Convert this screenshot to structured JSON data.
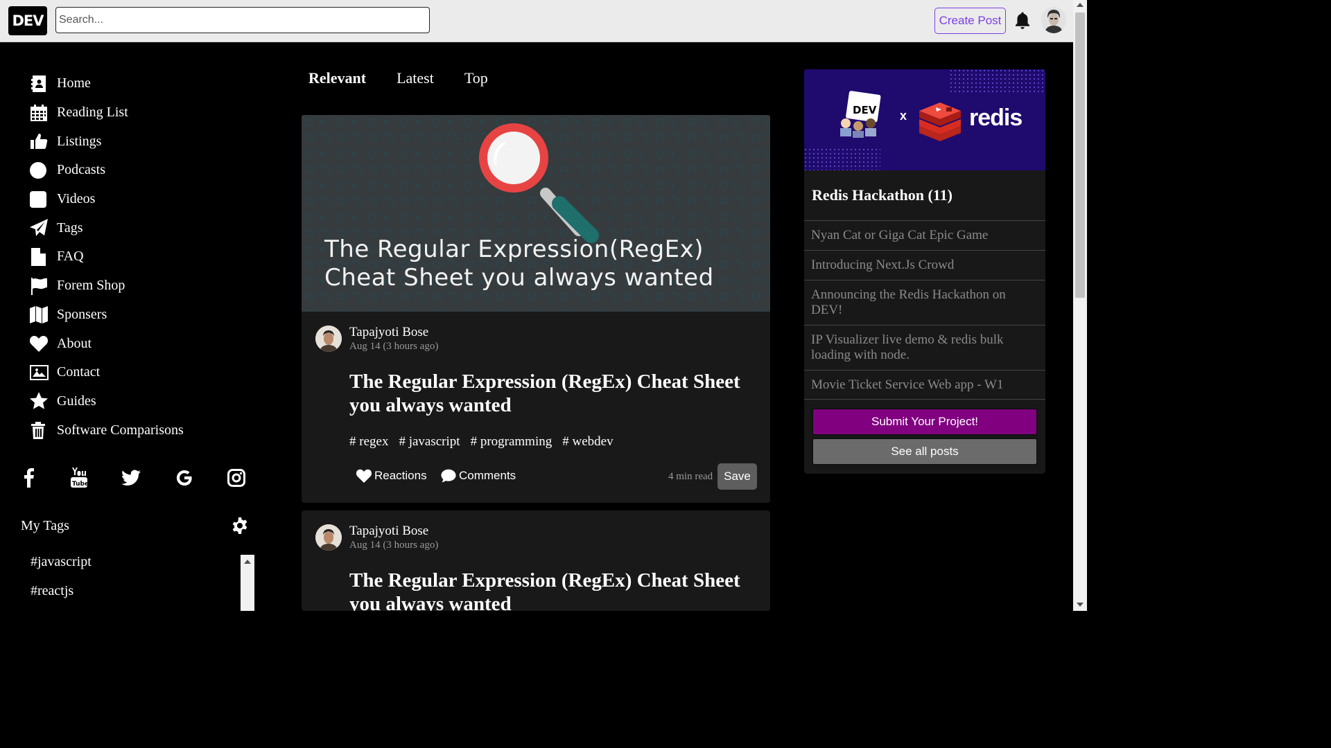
{
  "header": {
    "logo_text": "DEV",
    "search_placeholder": "Search...",
    "create_post_label": "Create Post"
  },
  "sidebar": {
    "items": [
      {
        "label": "Home",
        "icon": "contact-card-icon"
      },
      {
        "label": "Reading List",
        "icon": "calendar-icon"
      },
      {
        "label": "Listings",
        "icon": "thumbs-up-icon"
      },
      {
        "label": "Podcasts",
        "icon": "circle-icon"
      },
      {
        "label": "Videos",
        "icon": "square-icon"
      },
      {
        "label": "Tags",
        "icon": "paper-plane-icon"
      },
      {
        "label": "FAQ",
        "icon": "file-icon"
      },
      {
        "label": "Forem Shop",
        "icon": "flag-icon"
      },
      {
        "label": "Sponsers",
        "icon": "map-icon"
      },
      {
        "label": "About",
        "icon": "heart-icon"
      },
      {
        "label": "Contact",
        "icon": "image-icon"
      },
      {
        "label": "Guides",
        "icon": "star-icon"
      },
      {
        "label": "Software Comparisons",
        "icon": "trash-icon"
      }
    ],
    "social": [
      "facebook-icon",
      "youtube-icon",
      "twitter-icon",
      "google-icon",
      "instagram-icon"
    ],
    "my_tags_title": "My Tags",
    "tags": [
      "#javascript",
      "#reactjs"
    ]
  },
  "feed": {
    "tabs": [
      {
        "label": "Relevant",
        "active": true
      },
      {
        "label": "Latest",
        "active": false
      },
      {
        "label": "Top",
        "active": false
      }
    ],
    "posts": [
      {
        "cover_text_line1": "The Regular Expression(RegEx)",
        "cover_text_line2": "Cheat Sheet you always wanted",
        "author": "Tapajyoti Bose",
        "date": "Aug 14 (3 hours ago)",
        "title": "The Regular Expression (RegEx) Cheat Sheet you always wanted",
        "tags": [
          "# regex",
          "# javascript",
          "# programming",
          "# webdev"
        ],
        "reactions_label": "Reactions",
        "comments_label": "Comments",
        "read_time": "4 min read",
        "save_label": "Save"
      },
      {
        "author": "Tapajyoti Bose",
        "date": "Aug 14 (3 hours ago)",
        "title": "The Regular Expression (RegEx) Cheat Sheet you always wanted"
      }
    ]
  },
  "right": {
    "banner_dev_text": "DEV",
    "banner_x": "x",
    "banner_brand": "redis",
    "title": "Redis Hackathon (11)",
    "items": [
      "Nyan Cat or Giga Cat Epic Game",
      "Introducing Next.Js Crowd",
      "Announcing the Redis Hackathon on DEV!",
      "IP Visualizer live demo & redis bulk loading with node.",
      "Movie Ticket Service Web app - W1"
    ],
    "submit_label": "Submit Your Project!",
    "see_all_label": "See all posts",
    "colors": {
      "submit_bg": "#800080",
      "see_all_bg": "#6b6b6b",
      "banner_bg": "#1f0a6e",
      "redis_red": "#d82c20"
    }
  }
}
